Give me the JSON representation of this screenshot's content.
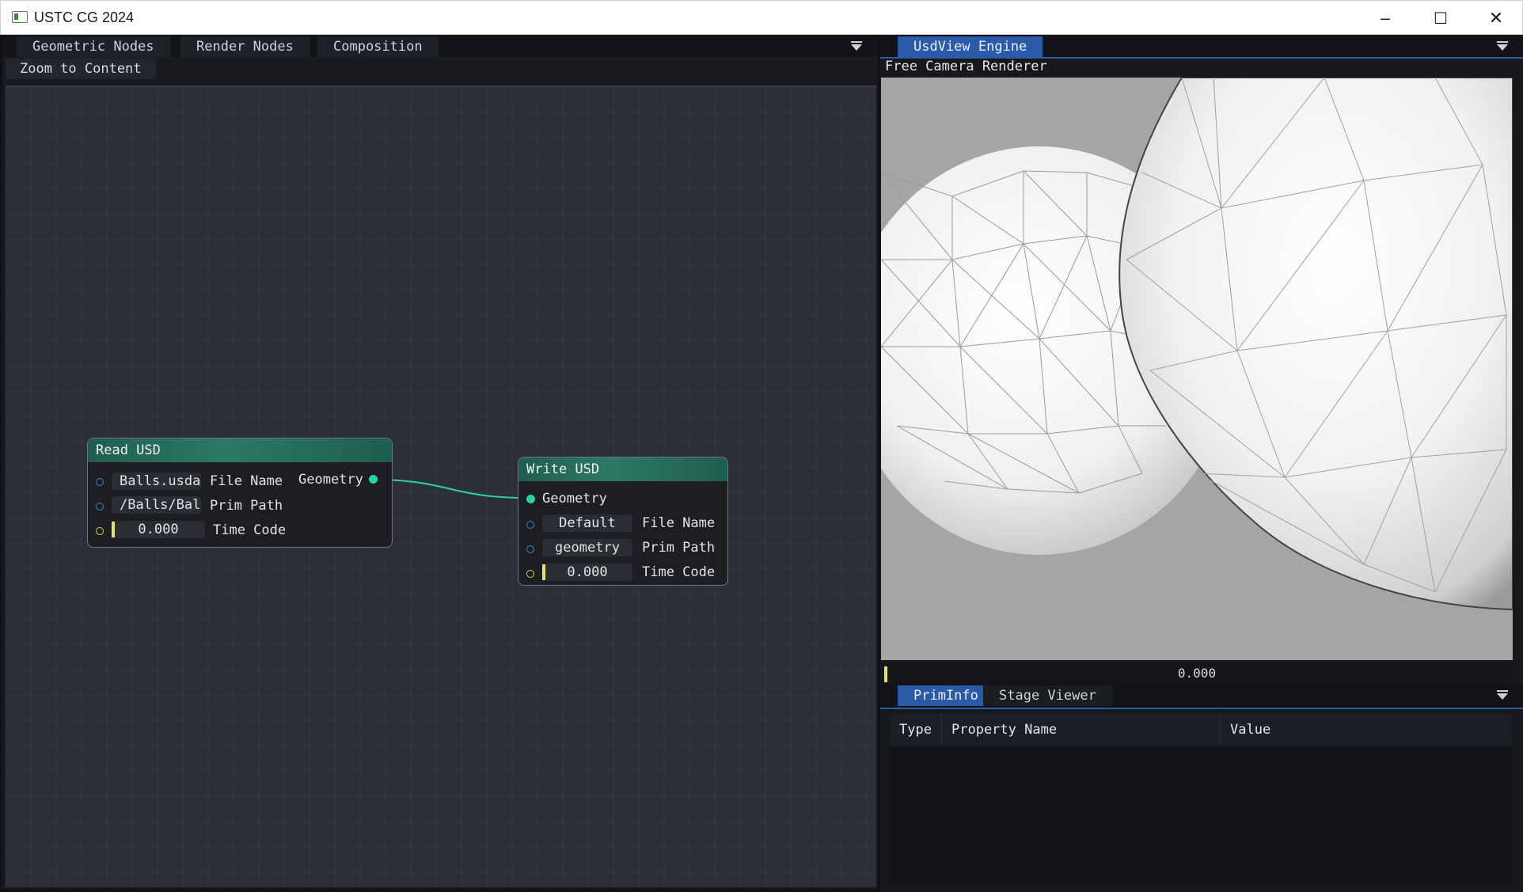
{
  "window": {
    "title": "USTC CG 2024",
    "minimize_glyph": "–",
    "maximize_glyph": "☐",
    "close_glyph": "✕"
  },
  "node_editor": {
    "tabs": [
      "Geometric Nodes",
      "Render Nodes",
      "Composition"
    ],
    "zoom_button": "Zoom to Content",
    "nodes": {
      "read_usd": {
        "title": "Read USD",
        "file_name_value": "Balls.usda",
        "file_name_label": "File Name",
        "prim_path_value": "/Balls/Balls",
        "prim_path_label": "Prim Path",
        "time_code_value": "0.000",
        "time_code_label": "Time Code",
        "output_label": "Geometry"
      },
      "write_usd": {
        "title": "Write USD",
        "input_label": "Geometry",
        "file_name_value": "Default",
        "file_name_label": "File Name",
        "prim_path_value": "geometry",
        "prim_path_label": "Prim Path",
        "time_code_value": "0.000",
        "time_code_label": "Time Code"
      }
    }
  },
  "usdview": {
    "tab": "UsdView Engine",
    "renderer_label": "Free Camera Renderer",
    "time_value": "0.000"
  },
  "prim_info": {
    "tabs": [
      "PrimInfo",
      "Stage Viewer"
    ],
    "columns": [
      "Type",
      "Property Name",
      "Value"
    ]
  },
  "colors": {
    "accent_blue": "#2a5aa8",
    "node_header": "#2c7a63",
    "link": "#2ad3a3",
    "time_grab": "#e8e06a"
  }
}
